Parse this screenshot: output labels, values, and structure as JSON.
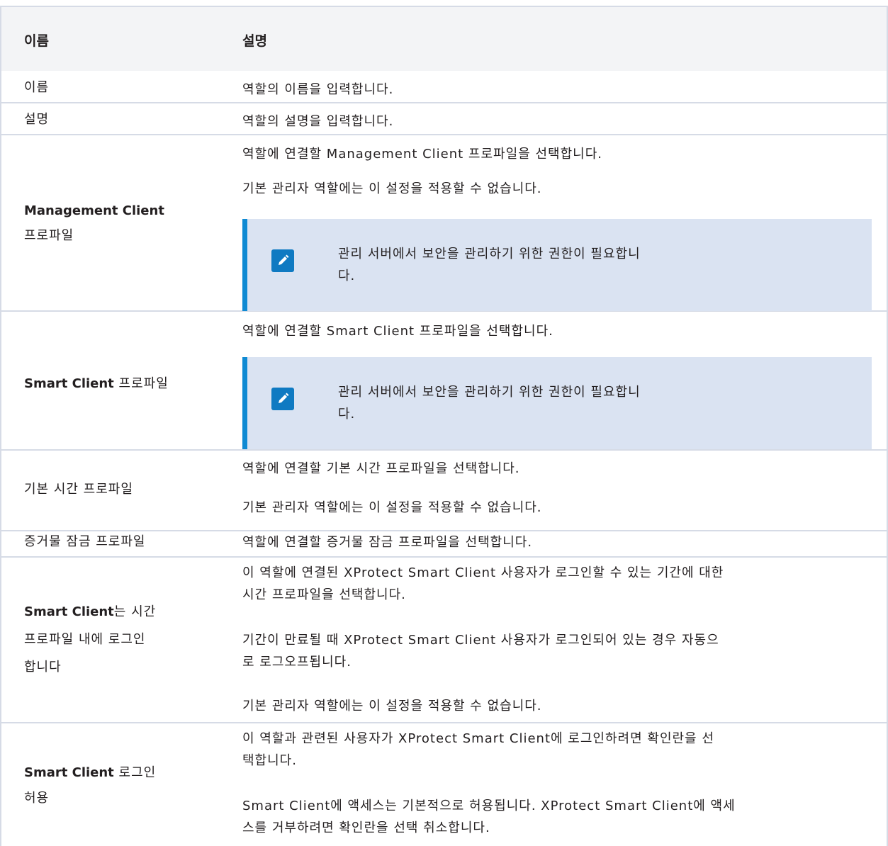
{
  "header": {
    "col_name": "이름",
    "col_desc": "설명"
  },
  "rows": {
    "name": {
      "label": "이름",
      "desc": "역할의 이름을 입력합니다."
    },
    "description": {
      "label": "설명",
      "desc": "역할의 설명을 입력합니다."
    },
    "mgmt_profile": {
      "label_bold": "Management Client",
      "label_rest": "프로파일",
      "p1": "역할에 연결할 Management Client 프로파일을 선택합니다.",
      "p2": "기본 관리자 역할에는 이 설정을 적용할 수 없습니다.",
      "note_line1": "관리 서버에서 보안을 관리하기 위한 권한이 필요합니",
      "note_line2": "다."
    },
    "smart_profile": {
      "label_bold": "Smart Client",
      "label_rest": " 프로파일",
      "p1": "역할에 연결할 Smart Client 프로파일을 선택합니다.",
      "note_line1": "관리 서버에서 보안을 관리하기 위한 권한이 필요합니",
      "note_line2": "다."
    },
    "default_time": {
      "label": "기본 시간 프로파일",
      "p1": "역할에 연결할 기본 시간 프로파일을 선택합니다.",
      "p2": "기본 관리자 역할에는 이 설정을 적용할 수 없습니다."
    },
    "evidence_lock": {
      "label": "증거물 잠금 프로파일",
      "desc": "역할에 연결할 증거물 잠금 프로파일을 선택합니다."
    },
    "login_time": {
      "label_bold": "Smart Client",
      "label_line1_rest": "는 시간",
      "label_line2": "프로파일 내에 로그인",
      "label_line3": "합니다",
      "p1_line1": "이 역할에 연결된 XProtect Smart Client 사용자가 로그인할 수 있는 기간에 대한",
      "p1_line2": "시간 프로파일을 선택합니다.",
      "p2_line1": "기간이 만료될 때 XProtect Smart Client 사용자가 로그인되어 있는 경우 자동으",
      "p2_line2": "로 로그오프됩니다.",
      "p3": "기본 관리자 역할에는 이 설정을 적용할 수 없습니다."
    },
    "login_allow": {
      "label_bold": "Smart Client",
      "label_line1_rest": " 로그인",
      "label_line2": "허용",
      "p1_line1": "이 역할과 관련된 사용자가 XProtect Smart Client에 로그인하려면 확인란을 선",
      "p1_line2": "택합니다.",
      "p2_line1": "Smart Client에 액세스는 기본적으로 허용됩니다. XProtect Smart Client에 액세",
      "p2_line2": "스를 거부하려면 확인란을 선택 취소합니다."
    }
  },
  "colors": {
    "header_bg": "#f3f4f6",
    "border": "#d6dbe6",
    "note_bg": "#dae3f2",
    "note_accent": "#0f8ad3"
  },
  "icons": {
    "note": "pencil-icon"
  }
}
